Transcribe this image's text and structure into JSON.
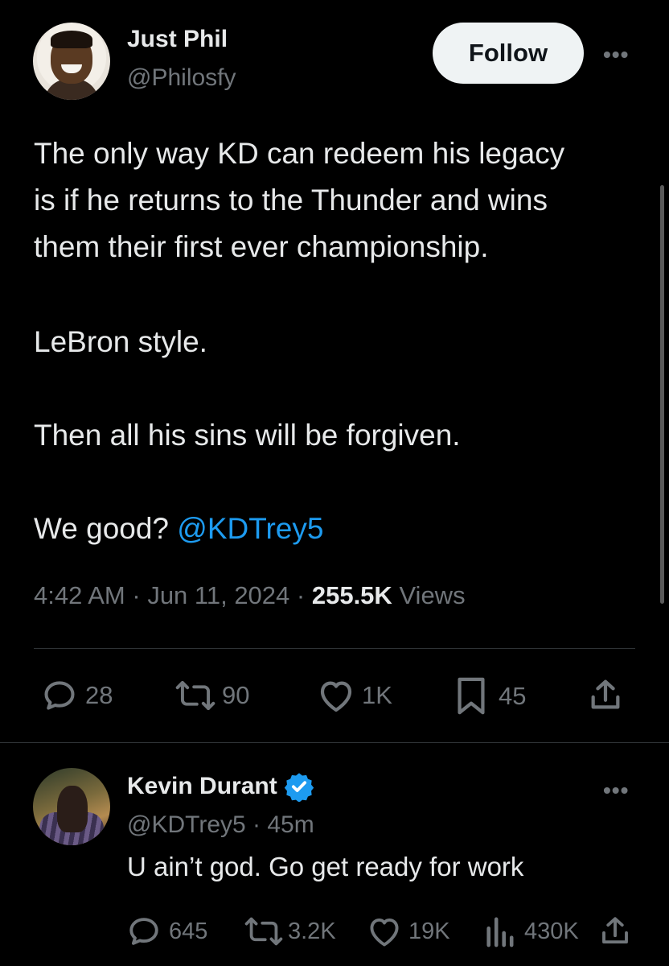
{
  "main_tweet": {
    "author_name": "Just Phil",
    "author_handle": "@Philosfy",
    "follow_label": "Follow",
    "more_label": "•••",
    "text_lines": [
      "The only way KD can redeem his legacy",
      "is if he returns to the Thunder and wins",
      "them their first ever championship."
    ],
    "line_lebron": "LeBron style.",
    "line_sins": "Then all his sins will be forgiven.",
    "line_good_prefix": "We good? ",
    "mention": "@KDTrey5",
    "time": "4:42 AM",
    "date": "Jun 11, 2024",
    "views_count": "255.5K",
    "views_label": "Views",
    "actions": {
      "replies": "28",
      "retweets": "90",
      "likes": "1K",
      "bookmarks": "45"
    }
  },
  "reply": {
    "author_name": "Kevin Durant",
    "author_handle": "@KDTrey5",
    "time_ago": "45m",
    "more_label": "•••",
    "text": "U ain’t god. Go get ready for work",
    "actions": {
      "replies": "645",
      "retweets": "3.2K",
      "likes": "19K",
      "views": "430K"
    }
  },
  "colors": {
    "background": "#000000",
    "text": "#e7e9ea",
    "secondary": "#71767b",
    "accent": "#1d9bf0",
    "divider": "#2f3336"
  }
}
